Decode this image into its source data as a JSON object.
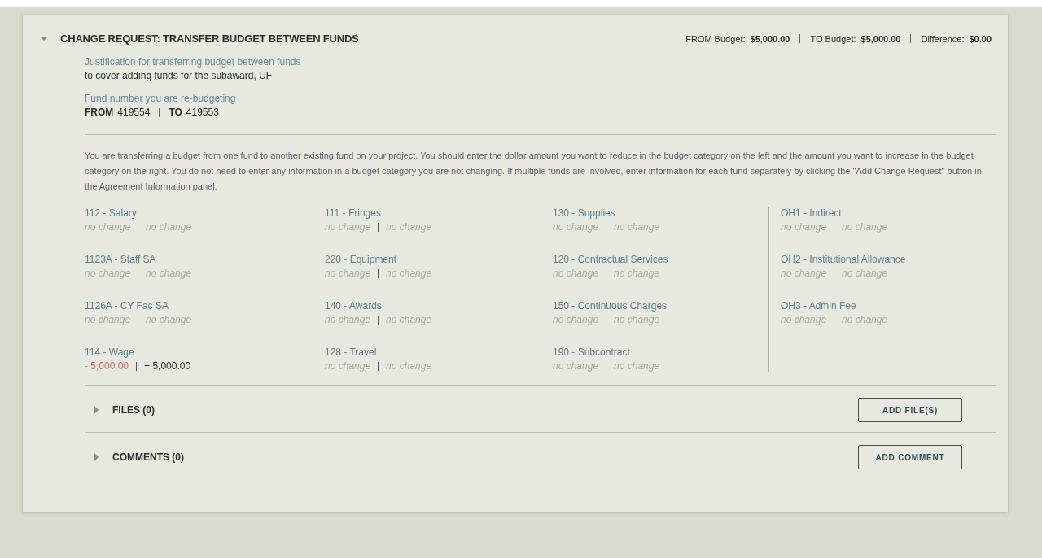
{
  "request": {
    "title": "CHANGE REQUEST: TRANSFER BUDGET BETWEEN FUNDS",
    "expanded": true,
    "summary": [
      {
        "label": "FROM Budget:",
        "value": "$5,000.00"
      },
      {
        "label": "TO Budget:",
        "value": "$5,000.00"
      },
      {
        "label": "Difference:",
        "value": "$0.00"
      }
    ],
    "justification": {
      "label": "Justification for transferring budget between funds",
      "value": "to cover adding funds for the subaward, UF"
    },
    "fund": {
      "label": "Fund number you are re-budgeting",
      "from_label": "FROM",
      "from": "419554",
      "to_label": "TO",
      "to": "419553"
    },
    "instructions": "You are transferring a budget from one fund to another existing fund on your project. You should enter the dollar amount you want to reduce in the budget category on the left and the amount you want to increase in the budget category on the right. You do not need to enter any information in a budget category you are not changing. If multiple funds are involved, enter information for each fund separately by clicking the \"Add Change Request\" button in the Agreement Information panel.",
    "columns": [
      [
        {
          "name": "112 - Salary",
          "from": {
            "kind": "none",
            "text": "no change"
          },
          "to": {
            "kind": "none",
            "text": "no change"
          }
        },
        {
          "name": "1123A - Staff SA",
          "from": {
            "kind": "none",
            "text": "no change"
          },
          "to": {
            "kind": "none",
            "text": "no change"
          }
        },
        {
          "name": "1126A - CY Fac SA",
          "from": {
            "kind": "none",
            "text": "no change"
          },
          "to": {
            "kind": "none",
            "text": "no change"
          }
        },
        {
          "name": "114 - Wage",
          "from": {
            "kind": "decrease",
            "text": "- 5,000.00"
          },
          "to": {
            "kind": "increase",
            "text": "+ 5,000.00"
          }
        }
      ],
      [
        {
          "name": "111 - Fringes",
          "from": {
            "kind": "none",
            "text": "no change"
          },
          "to": {
            "kind": "none",
            "text": "no change"
          }
        },
        {
          "name": "220 - Equipment",
          "from": {
            "kind": "none",
            "text": "no change"
          },
          "to": {
            "kind": "none",
            "text": "no change"
          }
        },
        {
          "name": "140 - Awards",
          "from": {
            "kind": "none",
            "text": "no change"
          },
          "to": {
            "kind": "none",
            "text": "no change"
          }
        },
        {
          "name": "128 - Travel",
          "from": {
            "kind": "none",
            "text": "no change"
          },
          "to": {
            "kind": "none",
            "text": "no change"
          }
        }
      ],
      [
        {
          "name": "130 - Supplies",
          "from": {
            "kind": "none",
            "text": "no change"
          },
          "to": {
            "kind": "none",
            "text": "no change"
          }
        },
        {
          "name": "120 - Contractual Services",
          "from": {
            "kind": "none",
            "text": "no change"
          },
          "to": {
            "kind": "none",
            "text": "no change"
          }
        },
        {
          "name": "150 - Continuous Charges",
          "from": {
            "kind": "none",
            "text": "no change"
          },
          "to": {
            "kind": "none",
            "text": "no change"
          }
        },
        {
          "name": "190 - Subcontract",
          "from": {
            "kind": "none",
            "text": "no change"
          },
          "to": {
            "kind": "none",
            "text": "no change"
          }
        }
      ],
      [
        {
          "name": "OH1 - Indirect",
          "from": {
            "kind": "none",
            "text": "no change"
          },
          "to": {
            "kind": "none",
            "text": "no change"
          }
        },
        {
          "name": "OH2 - Institutional Allowance",
          "from": {
            "kind": "none",
            "text": "no change"
          },
          "to": {
            "kind": "none",
            "text": "no change"
          }
        },
        {
          "name": "OH3 - Admin Fee",
          "from": {
            "kind": "none",
            "text": "no change"
          },
          "to": {
            "kind": "none",
            "text": "no change"
          }
        }
      ]
    ],
    "sections": [
      {
        "title": "FILES (0)",
        "expanded": false,
        "button": "ADD FILE(S)"
      },
      {
        "title": "COMMENTS (0)",
        "expanded": false,
        "button": "ADD COMMENT"
      }
    ]
  }
}
